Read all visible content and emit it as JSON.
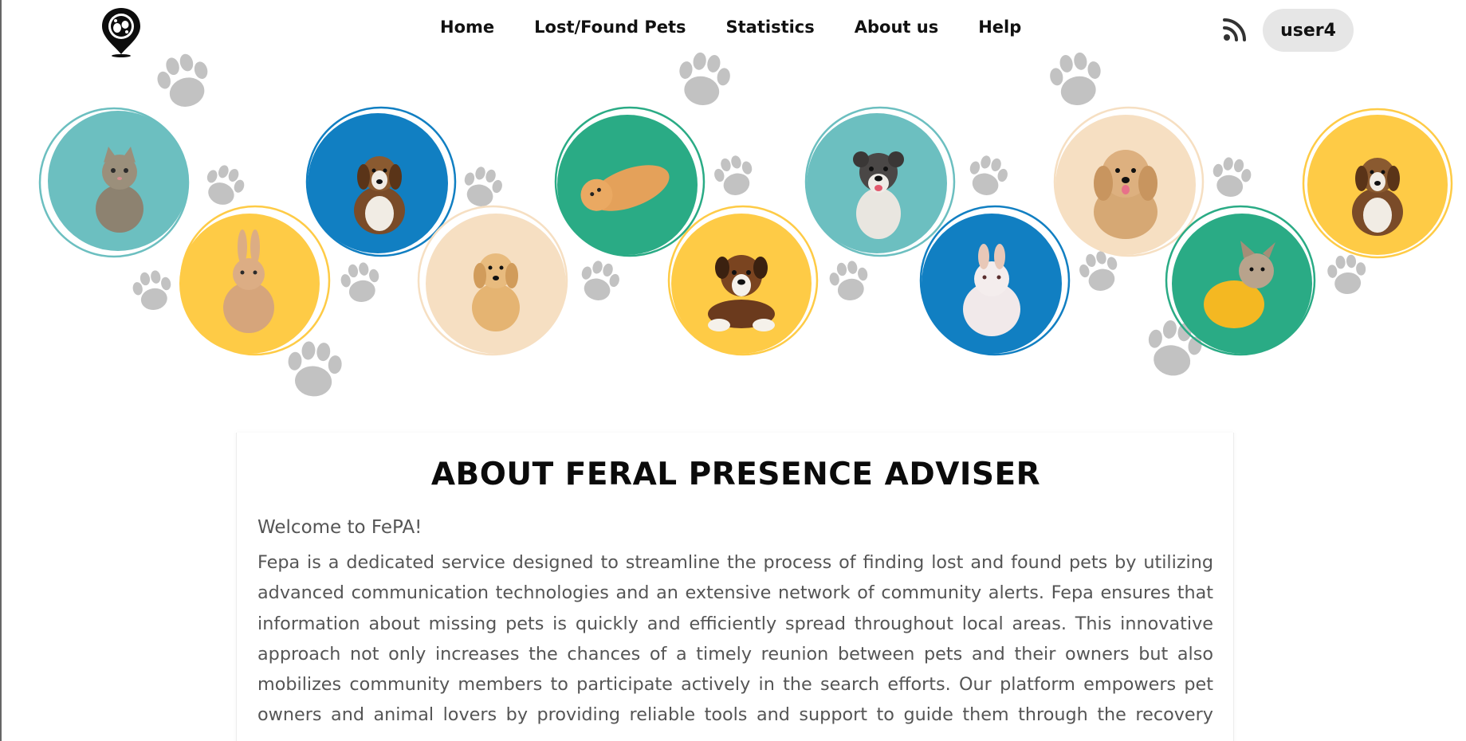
{
  "nav": {
    "logo_icon": "paw-location-pin-icon",
    "menu": [
      {
        "label": "Home"
      },
      {
        "label": "Lost/Found Pets"
      },
      {
        "label": "Statistics"
      },
      {
        "label": "About us"
      },
      {
        "label": "Help"
      }
    ],
    "feed_icon": "rss-feed-icon",
    "user_label": "user4"
  },
  "hero": {
    "description_icons": [
      "paw-print-icon",
      "pet-photo-circle"
    ],
    "colors": {
      "teal": "#6cbfc0",
      "blue": "#117fc2",
      "green": "#2aab85",
      "yellow": "#fecb46",
      "peach": "#f6dfc2",
      "paw": "#c2c2c2"
    }
  },
  "about": {
    "title": "ABOUT FERAL PRESENCE ADVISER",
    "welcome": "Welcome to FePA!",
    "description": "Fepa is a dedicated service designed to streamline the process of finding lost and found pets by utilizing advanced communication technologies and an extensive network of community alerts. Fepa ensures that information about missing pets is quickly and efficiently spread throughout local areas. This innovative approach not only increases the chances of a timely reunion between pets and their owners but also mobilizes community members to participate actively in the search efforts. Our platform empowers pet owners and animal lovers by providing reliable tools and support to guide them through the recovery proces"
  }
}
